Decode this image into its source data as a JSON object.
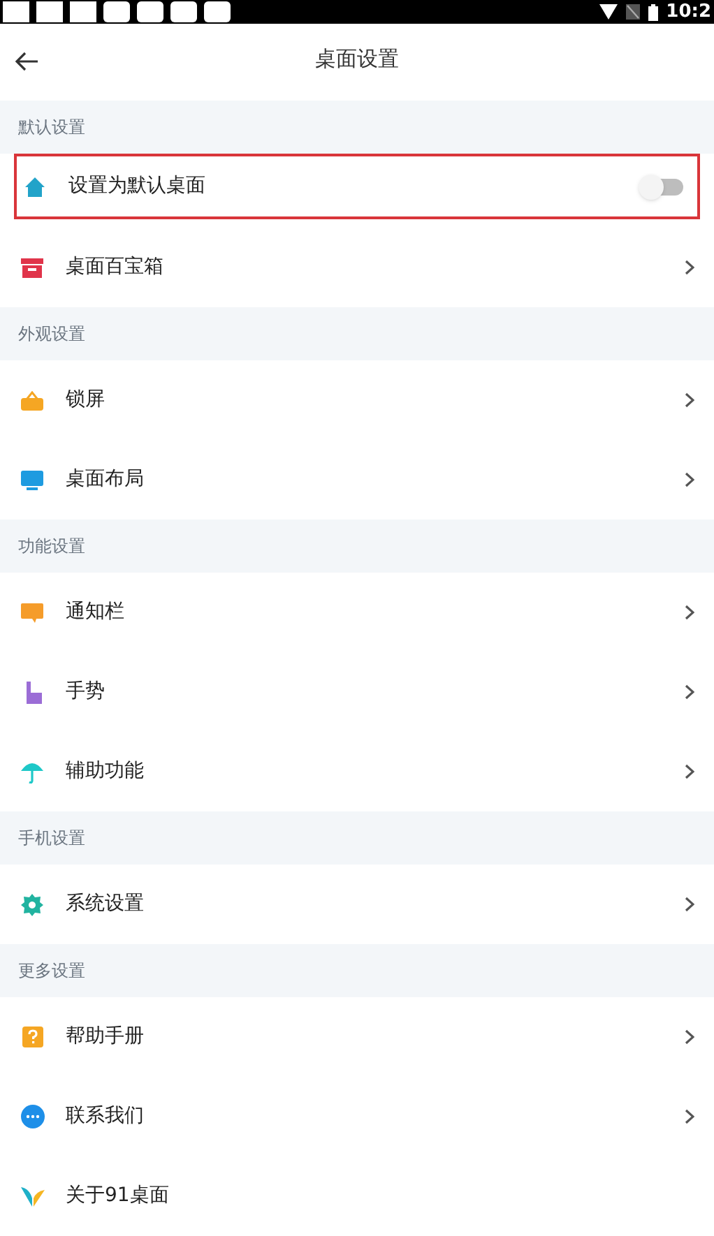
{
  "status_bar": {
    "time": "10:2"
  },
  "header": {
    "title": "桌面设置"
  },
  "sections": [
    {
      "title": "默认设置",
      "items": [
        {
          "kind": "toggle",
          "label": "设置为默认桌面",
          "on": false,
          "highlighted": true
        },
        {
          "kind": "link",
          "label": "桌面百宝箱",
          "highlighted": false
        }
      ]
    },
    {
      "title": "外观设置",
      "items": [
        {
          "kind": "link",
          "label": "锁屏",
          "highlighted": false
        },
        {
          "kind": "link",
          "label": "桌面布局",
          "highlighted": false
        }
      ]
    },
    {
      "title": "功能设置",
      "items": [
        {
          "kind": "link",
          "label": "通知栏",
          "highlighted": false
        },
        {
          "kind": "link",
          "label": "手势",
          "highlighted": false
        },
        {
          "kind": "link",
          "label": "辅助功能",
          "highlighted": false
        }
      ]
    },
    {
      "title": "手机设置",
      "items": [
        {
          "kind": "link",
          "label": "系统设置",
          "highlighted": false
        }
      ]
    },
    {
      "title": "更多设置",
      "items": [
        {
          "kind": "link",
          "label": "帮助手册",
          "highlighted": false
        },
        {
          "kind": "link",
          "label": "联系我们",
          "highlighted": false
        },
        {
          "kind": "plain",
          "label": "关于91桌面",
          "highlighted": false
        }
      ]
    }
  ]
}
